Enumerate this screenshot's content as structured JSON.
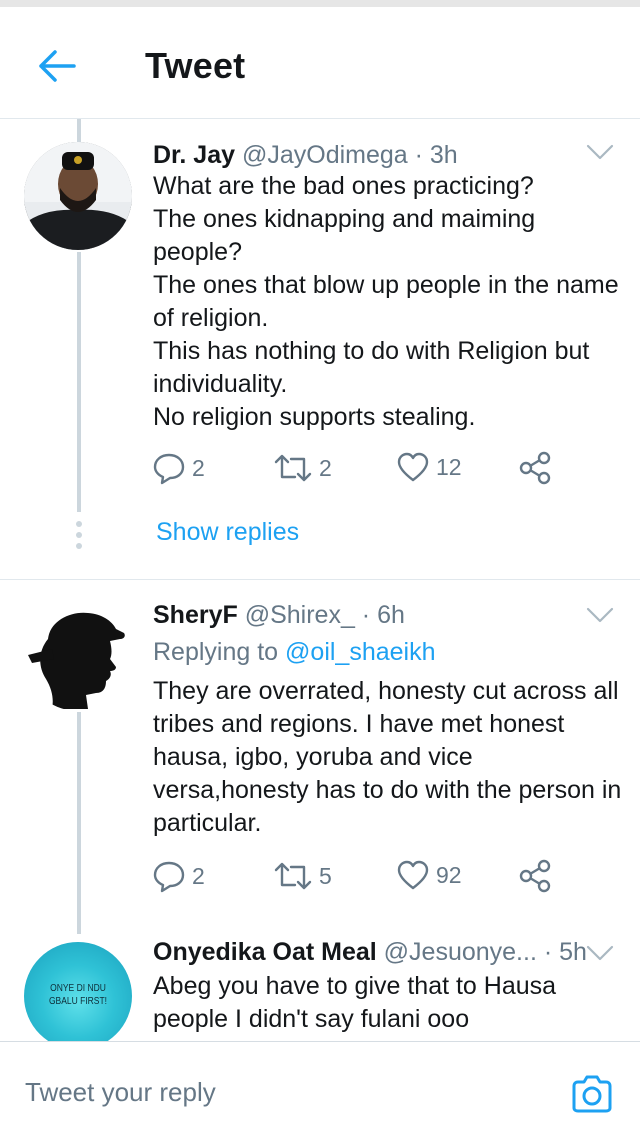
{
  "header": {
    "title": "Tweet"
  },
  "tweets": [
    {
      "name": "Dr. Jay",
      "meta": "@JayOdimega · 3h",
      "lines": [
        "What are the bad ones practicing?",
        "The ones kidnapping and maiming",
        "people?",
        "The ones that blow up people in the name",
        "of religion.",
        "This has nothing to do with Religion but",
        "individuality.",
        "No religion supports stealing."
      ],
      "replies": "2",
      "retweets": "2",
      "likes": "12",
      "show_replies": "Show replies"
    },
    {
      "name": "SheryF",
      "meta": "@Shirex_ · 6h",
      "replying_prefix": "Replying to",
      "replying_handle": "@oil_shaeikh",
      "lines": [
        "They are overrated, honesty cut across all",
        "tribes and regions. I have met honest",
        "hausa, igbo, yoruba and vice",
        "versa,honesty has to do with the person in",
        "particular."
      ],
      "replies": "2",
      "retweets": "5",
      "likes": "92"
    },
    {
      "name": "Onyedika Oat Meal",
      "meta": "@Jesuonye... · 5h",
      "avatar_text": [
        "ONYE DI NDU",
        "GBALU FIRST!"
      ],
      "lines": [
        "Abeg you have to give that to Hausa",
        "people I didn't say fulani ooo"
      ]
    }
  ],
  "composer": {
    "placeholder": "Tweet your reply"
  },
  "colors": {
    "accent": "#1da1f2",
    "secondary_text": "#657786",
    "primary_text": "#14171a"
  },
  "icons": [
    "back-arrow-icon",
    "chevron-down-icon",
    "reply-icon",
    "retweet-icon",
    "like-icon",
    "share-icon",
    "camera-icon"
  ]
}
